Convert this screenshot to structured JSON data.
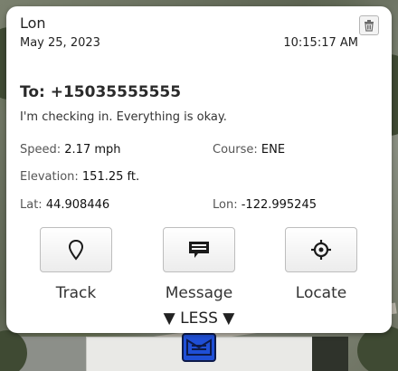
{
  "popup": {
    "title": "Lon",
    "date": "May 25, 2023",
    "time": "10:15:17 AM",
    "to": "To: +15035555555",
    "message": "I'm checking in. Everything is okay.",
    "speed_label": "Speed: ",
    "speed_value": "2.17 mph",
    "course_label": "Course: ",
    "course_value": "ENE",
    "elevation_label": "Elevation: ",
    "elevation_value": "151.25 ft.",
    "lat_label": "Lat: ",
    "lat_value": "44.908446",
    "lon_label": "Lon: ",
    "lon_value": "-122.995245",
    "actions": [
      {
        "label": "Track",
        "icon": "map-pin-icon"
      },
      {
        "label": "Message",
        "icon": "message-icon"
      },
      {
        "label": "Locate",
        "icon": "crosshair-icon"
      }
    ],
    "less_label": "▼ LESS ▼"
  },
  "colors": {
    "marker": "#1f4fd6",
    "card_bg": "#ffffff"
  }
}
